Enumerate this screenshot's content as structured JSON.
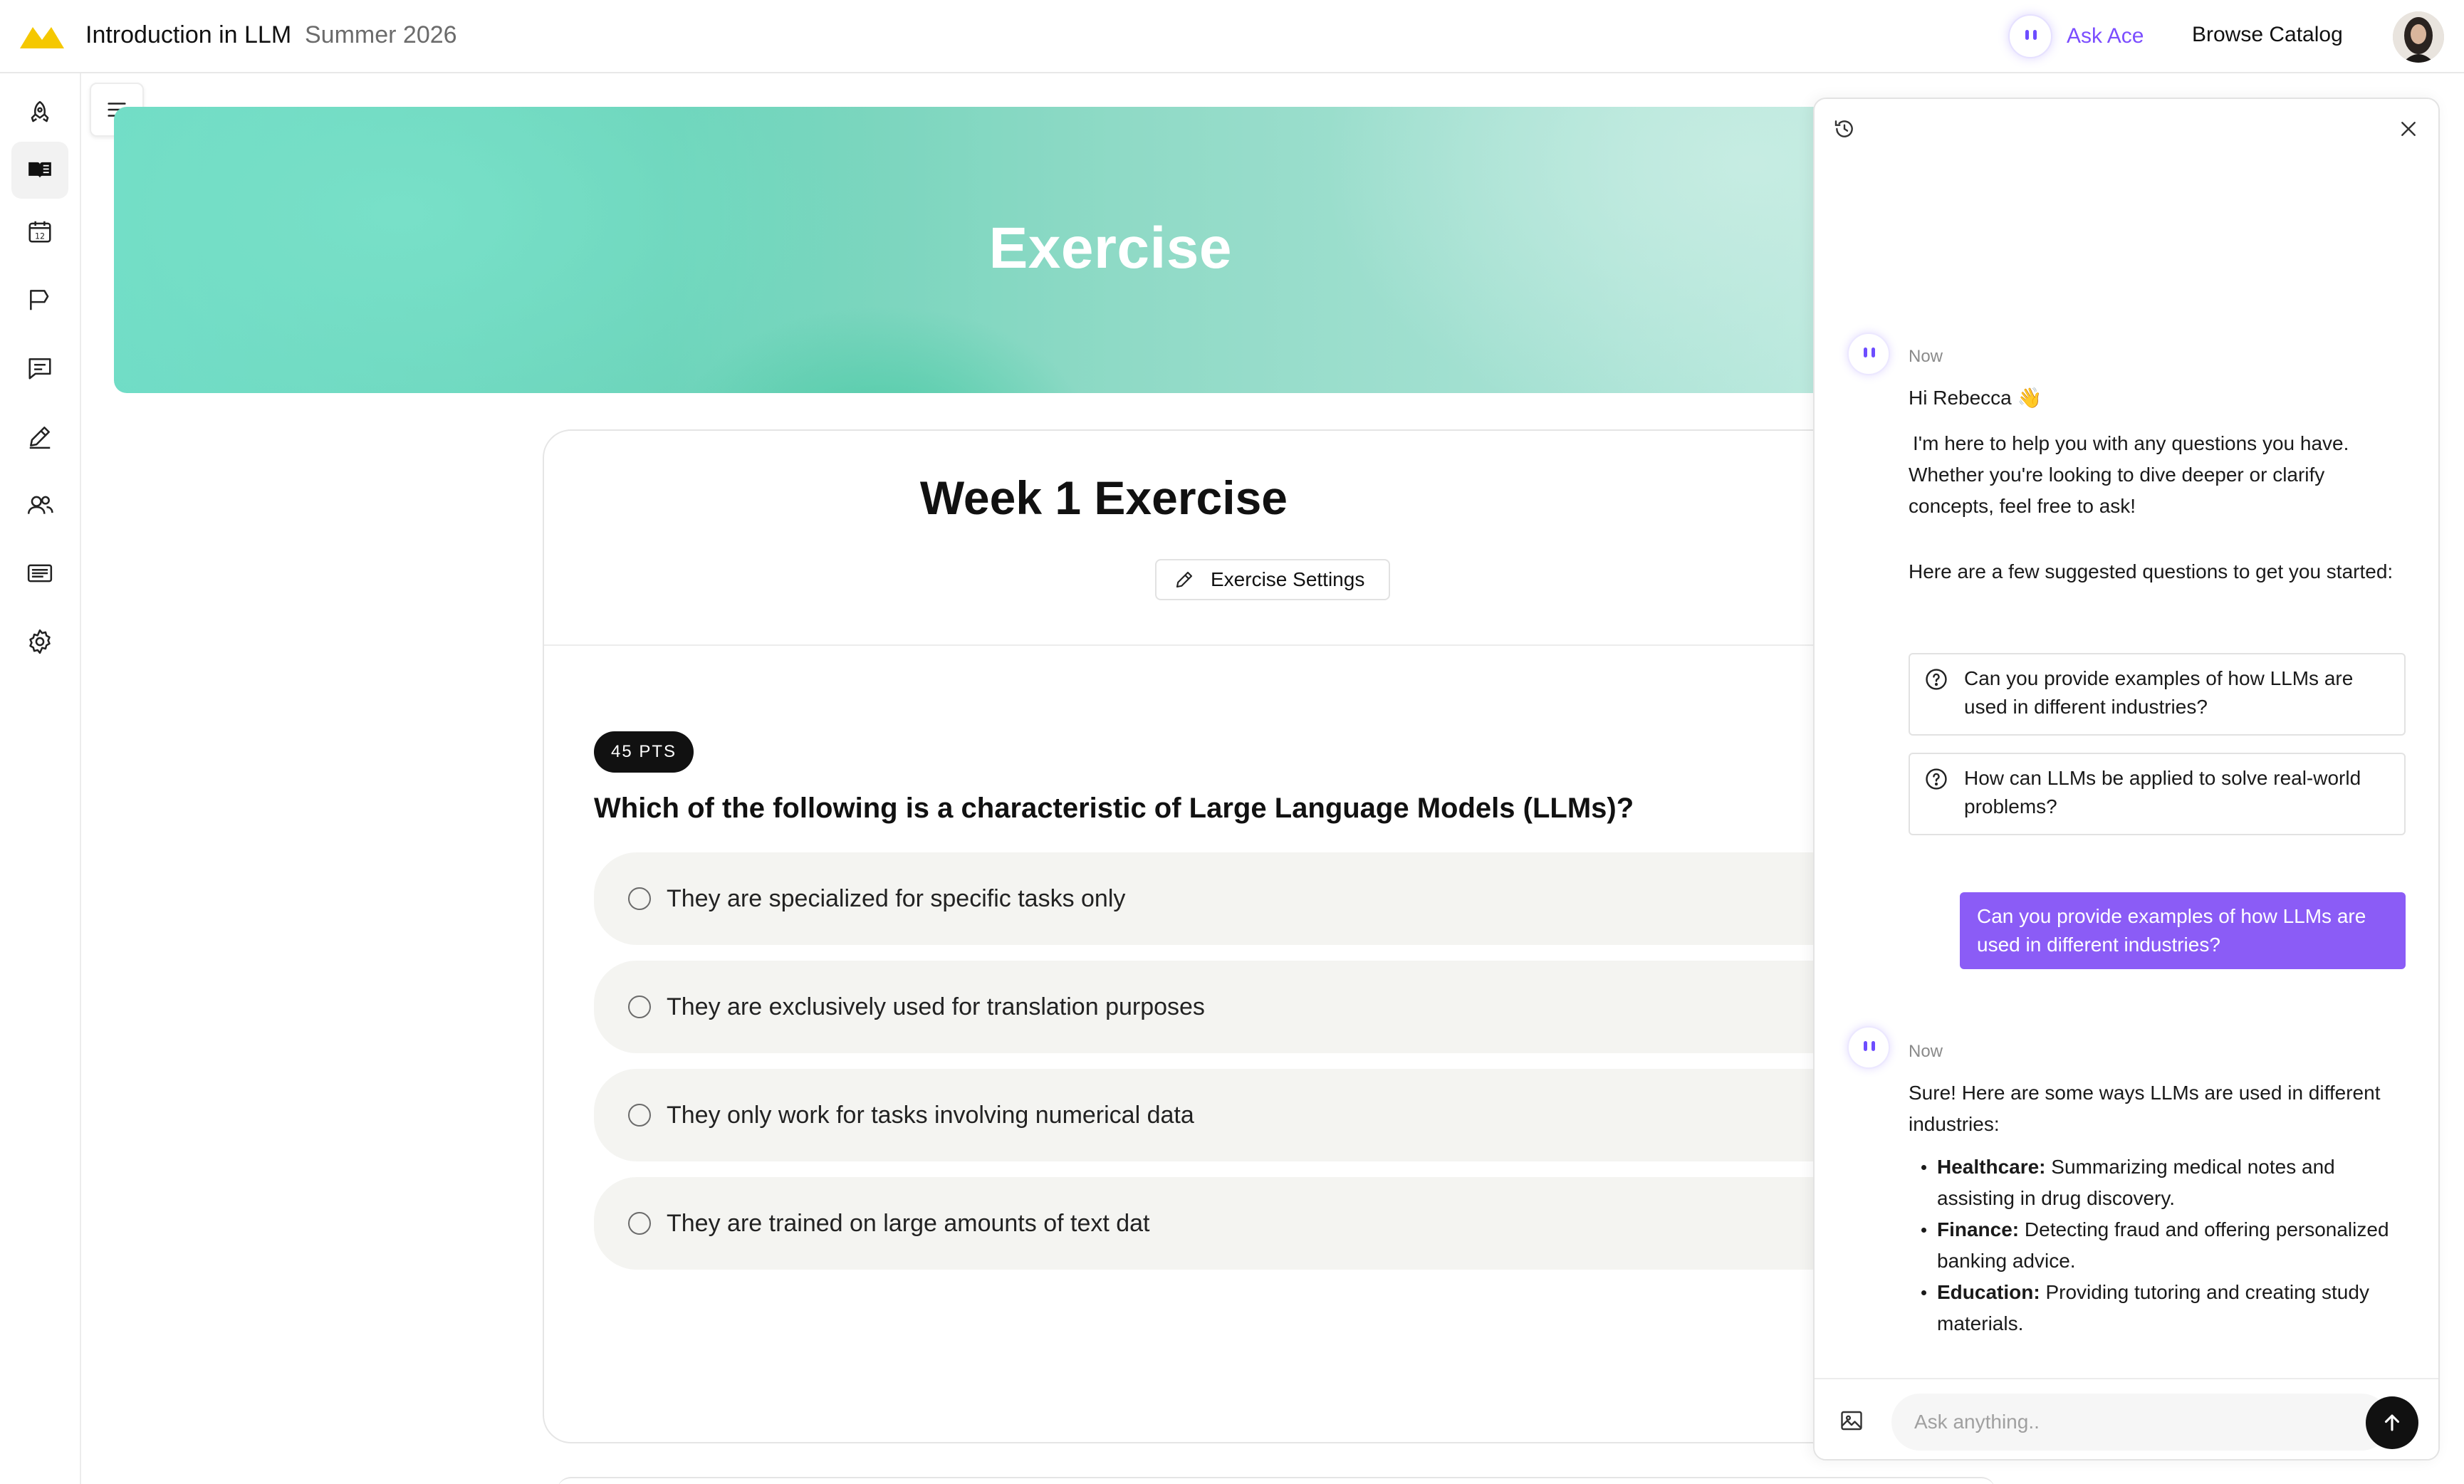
{
  "header": {
    "course_title": "Introduction in LLM",
    "course_term": "Summer 2026",
    "ask_ace_label": "Ask Ace",
    "browse_catalog_label": "Browse Catalog"
  },
  "sidebar": {
    "items": [
      {
        "icon": "rocket-icon"
      },
      {
        "icon": "book-open-icon",
        "active": true
      },
      {
        "icon": "calendar-icon"
      },
      {
        "icon": "flag-icon"
      },
      {
        "icon": "chat-icon"
      },
      {
        "icon": "pencil-icon"
      },
      {
        "icon": "users-icon"
      },
      {
        "icon": "list-card-icon"
      },
      {
        "icon": "gear-icon"
      }
    ]
  },
  "banner": {
    "title": "Exercise"
  },
  "exercise": {
    "title": "Week 1 Exercise",
    "settings_label": "Exercise Settings",
    "points_badge": "45 PTS",
    "question": "Which of the following is a characteristic of Large Language Models (LLMs)?",
    "options": [
      "They are specialized for specific tasks only",
      "They are exclusively used for translation purposes",
      "They only work for tasks involving numerical data",
      "They are trained on large amounts of text dat"
    ]
  },
  "chat": {
    "messages": {
      "greeting_time": "Now",
      "greeting_hi": "Hi Rebecca 👋",
      "greeting_body": "I'm here to help you with any questions you have. Whether you're looking to dive deeper or clarify concepts, feel free to ask!",
      "suggest_intro": "Here are a few suggested questions to get you started:",
      "suggestions": [
        "Can you provide examples of how LLMs are used in different industries?",
        "How can LLMs be applied to solve real-world problems?"
      ],
      "user_message": "Can you provide examples of how LLMs are used in different industries?",
      "reply_time": "Now",
      "reply_intro": "Sure! Here are some ways LLMs are used in different industries:",
      "reply_bullets": [
        {
          "label": "Healthcare:",
          "text": " Summarizing medical notes and assisting in drug discovery."
        },
        {
          "label": "Finance:",
          "text": " Detecting fraud and offering personalized banking advice."
        },
        {
          "label": "Education:",
          "text": " Providing tutoring and creating study materials."
        }
      ]
    },
    "input_placeholder": "Ask anything.."
  },
  "colors": {
    "accent_purple": "#8b5cf6",
    "ace_purple": "#7b4dff",
    "banner_teal": "#6fdcc6",
    "logo_yellow": "#f5c800"
  }
}
